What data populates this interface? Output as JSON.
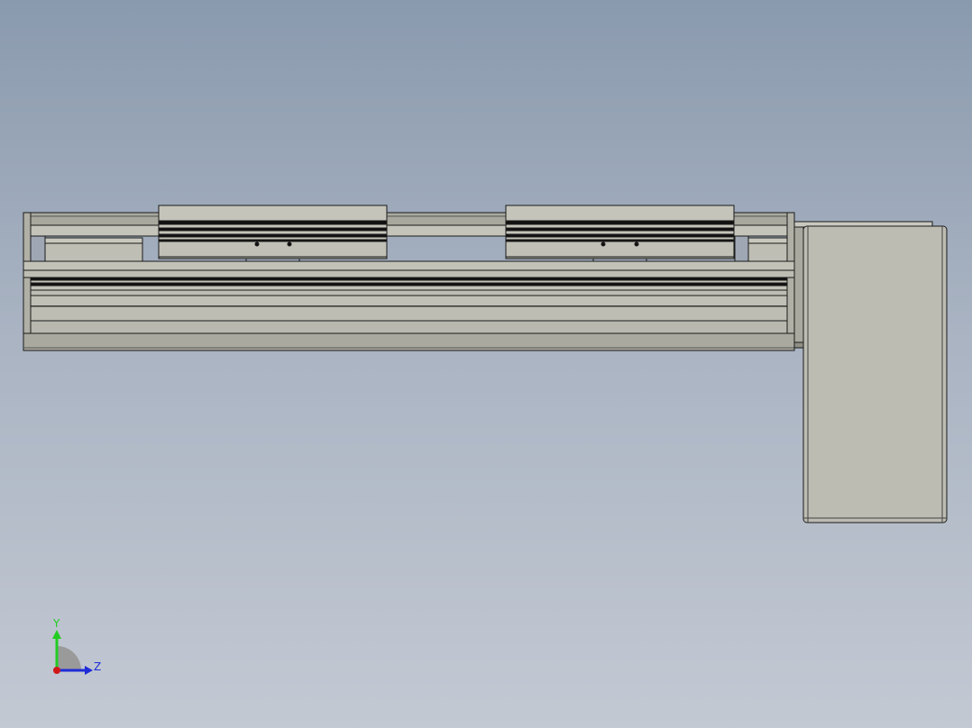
{
  "window": {
    "title": ""
  },
  "viewport": {
    "background_top": "#8a9aae",
    "background_bottom": "#c3c9d3",
    "part_fill": "#bcbcb2",
    "part_fill_dark": "#a9a99f",
    "edge_color": "#1a1a1a"
  },
  "model": {
    "component": "linear-actuator-module",
    "carriages": [
      "carriage-left",
      "carriage-right"
    ],
    "motor": "motor-housing"
  },
  "triad": {
    "y_label": "Y",
    "z_label": "Z",
    "y_color": "#22cc22",
    "z_color": "#1e2bd8",
    "x_color": "#d01818"
  }
}
